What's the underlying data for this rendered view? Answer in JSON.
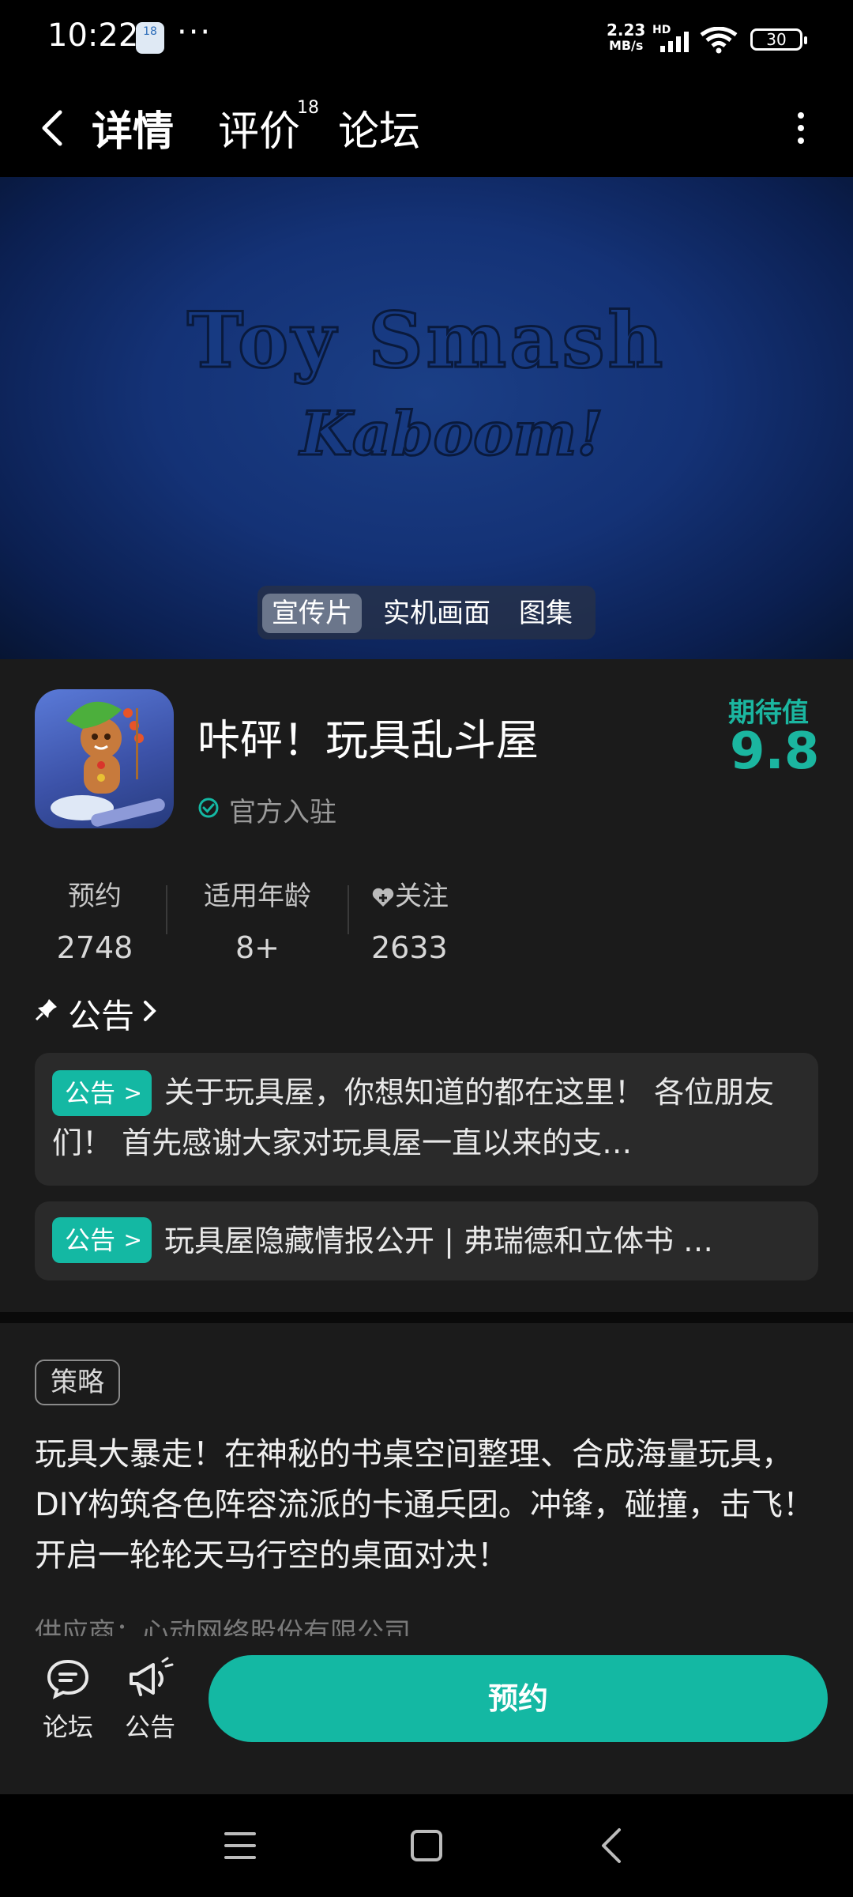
{
  "status_bar": {
    "time": "10:22",
    "app_badge": "18",
    "dots": "···",
    "net_speed_value": "2.23",
    "net_speed_unit": "MB/s",
    "hd": "HD",
    "battery": "30"
  },
  "header": {
    "tabs": [
      {
        "label": "详情"
      },
      {
        "label": "评价",
        "count": "18"
      },
      {
        "label": "论坛"
      }
    ]
  },
  "media": {
    "title_art": "Toy Smash",
    "subtitle_art": "Kaboom!",
    "tabs": [
      "宣传片",
      "实机画面",
      "图集"
    ]
  },
  "app": {
    "name": "咔砰！玩具乱斗屋",
    "verified": "官方入驻",
    "expect_label": "期待值",
    "expect_value": "9.8"
  },
  "stats": [
    {
      "label": "预约",
      "value": "2748"
    },
    {
      "label": "适用年龄",
      "value": "8+"
    },
    {
      "label": "关注",
      "value": "2633"
    }
  ],
  "notices": {
    "title": "公告",
    "items": [
      {
        "badge": "公告",
        "text": "关于玩具屋，你想知道的都在这里！ 各位朋友们！ 首先感谢大家对玩具屋一直以来的支…"
      },
      {
        "badge": "公告",
        "text": "玩具屋隐藏情报公开 | 弗瑞德和立体书 …"
      }
    ]
  },
  "description": {
    "tag": "策略",
    "text": "玩具大暴走！在神秘的书桌空间整理、合成海量玩具，DIY构筑各色阵容流派的卡通兵团。冲锋，碰撞，击飞！开启一轮轮天马行空的桌面对决！",
    "supplier": "供应商：心动网络股份有限公司"
  },
  "action_bar": {
    "forum": "论坛",
    "notice": "公告",
    "reserve": "预约"
  },
  "colors": {
    "accent": "#14b8a3",
    "background": "#1b1b1b"
  }
}
